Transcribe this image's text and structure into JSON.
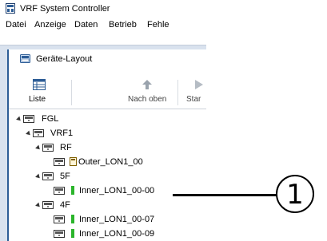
{
  "window": {
    "title": "VRF System Controller",
    "icon": "app-icon"
  },
  "menu": {
    "items": [
      "Datei",
      "Anzeige",
      "Daten",
      "Betrieb",
      "Fehle"
    ]
  },
  "document": {
    "title": "Geräte-Layout",
    "icon": "layout-icon"
  },
  "toolbar": {
    "list_label": "Liste",
    "up_label": "Nach oben",
    "start_label": "Star"
  },
  "tree": {
    "nodes": [
      {
        "label": "FGL",
        "icon": "device-icon",
        "expanded": true
      },
      {
        "label": "VRF1",
        "icon": "device-icon",
        "expanded": true
      },
      {
        "label": "RF",
        "icon": "device-icon",
        "expanded": true
      },
      {
        "label": "Outer_LON1_00",
        "icon": "outdoor-unit-icon"
      },
      {
        "label": "5F",
        "icon": "device-icon",
        "expanded": true
      },
      {
        "label": "Inner_LON1_00-00",
        "icon": "indoor-unit-icon",
        "status_color": "#2bb52b"
      },
      {
        "label": "4F",
        "icon": "device-icon",
        "expanded": true
      },
      {
        "label": "Inner_LON1_00-07",
        "icon": "indoor-unit-icon",
        "status_color": "#2bb52b"
      },
      {
        "label": "Inner_LON1_00-09",
        "icon": "indoor-unit-icon",
        "status_color": "#2bb52b"
      }
    ]
  },
  "callout": {
    "number": "1"
  }
}
